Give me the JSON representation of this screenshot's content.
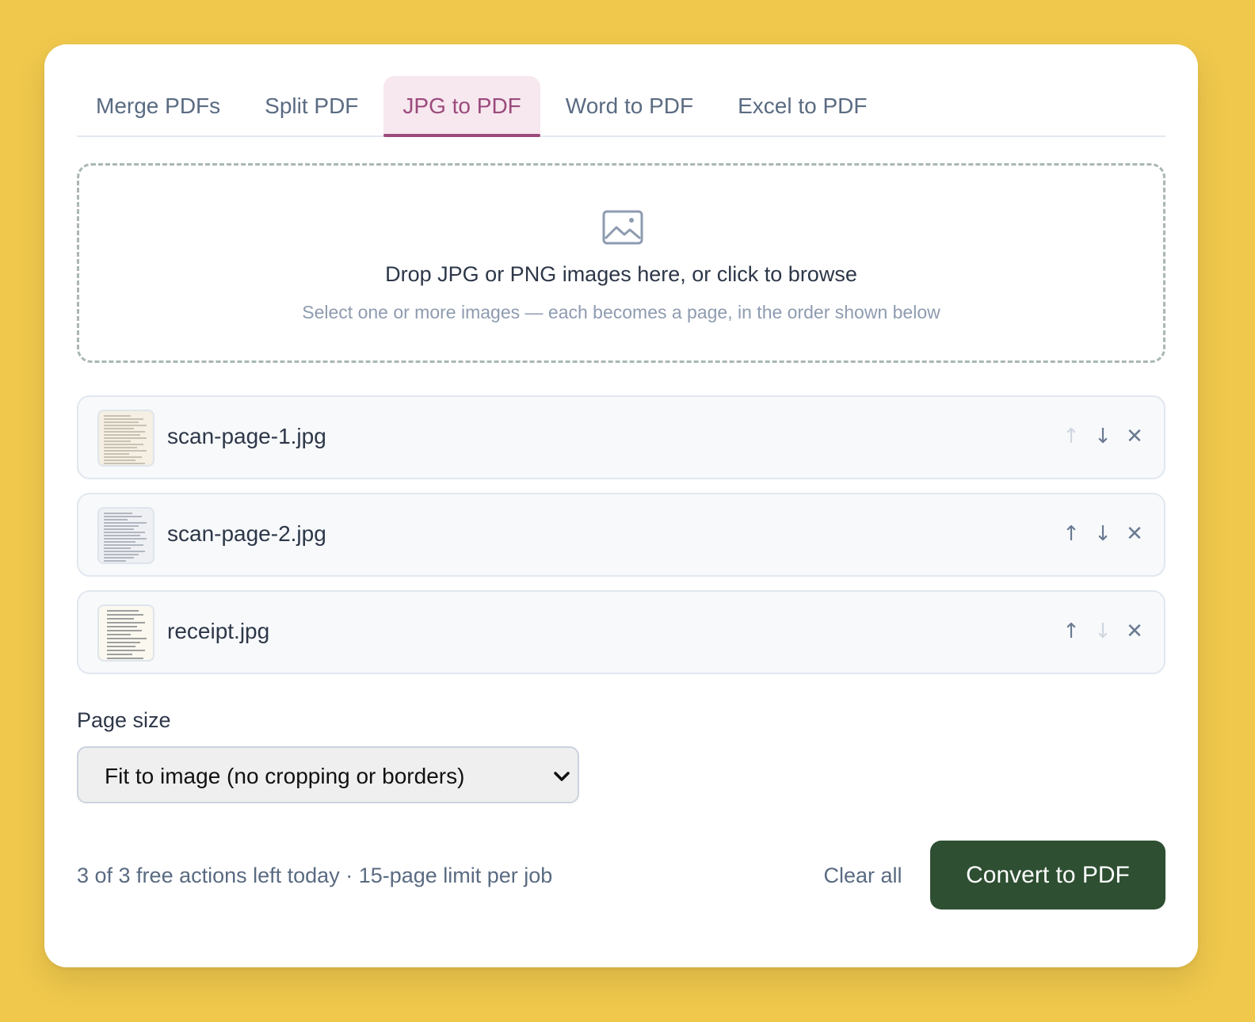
{
  "tabs": [
    {
      "label": "Merge PDFs",
      "active": false
    },
    {
      "label": "Split PDF",
      "active": false
    },
    {
      "label": "JPG to PDF",
      "active": true
    },
    {
      "label": "Word to PDF",
      "active": false
    },
    {
      "label": "Excel to PDF",
      "active": false
    }
  ],
  "dropzone": {
    "icon": "image-icon",
    "title": "Drop JPG or PNG images here, or click to browse",
    "subtitle": "Select one or more images — each becomes a page, in the order shown below"
  },
  "files": [
    {
      "name": "scan-page-1.jpg",
      "move_up_enabled": false,
      "move_down_enabled": true
    },
    {
      "name": "scan-page-2.jpg",
      "move_up_enabled": true,
      "move_down_enabled": true
    },
    {
      "name": "receipt.jpg",
      "move_up_enabled": true,
      "move_down_enabled": false
    }
  ],
  "icons": {
    "move_up": "↑",
    "move_down": "↓",
    "remove": "✕"
  },
  "page_size": {
    "label": "Page size",
    "selected": "Fit to image (no cropping or borders)"
  },
  "footer": {
    "usage_note": "3 of 3 free actions left today · 15-page limit per job",
    "clear_label": "Clear all",
    "convert_label": "Convert to PDF"
  },
  "colors": {
    "page_background": "#efc84c",
    "active_tab": "#9b4a7c",
    "active_tab_background": "#f7e7ef",
    "primary_button": "#2e4f32"
  }
}
